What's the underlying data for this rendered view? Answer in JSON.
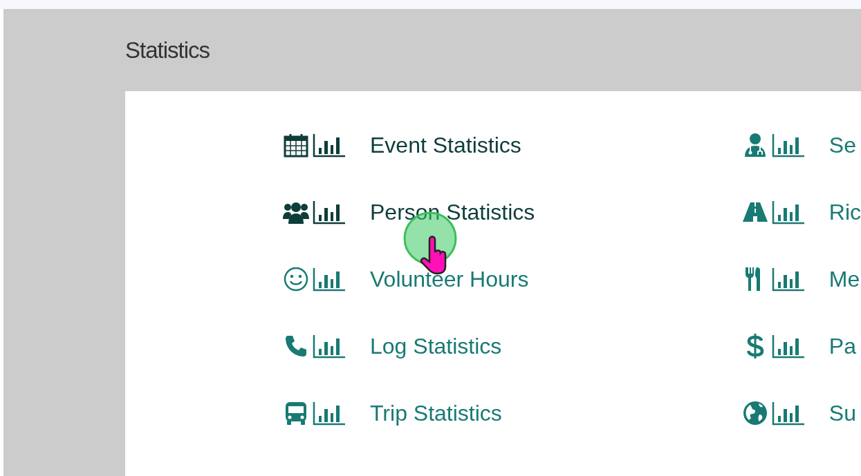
{
  "page": {
    "title": "Statistics"
  },
  "columns": [
    {
      "items": [
        {
          "kind": "calendar",
          "label": "Event Statistics",
          "visited": true
        },
        {
          "kind": "people",
          "label": "Person Statistics",
          "visited": true
        },
        {
          "kind": "smiley",
          "label": "Volunteer Hours",
          "visited": false
        },
        {
          "kind": "phone",
          "label": "Log Statistics",
          "visited": false
        },
        {
          "kind": "bus",
          "label": "Trip Statistics",
          "visited": false
        }
      ]
    },
    {
      "items": [
        {
          "kind": "doctor",
          "label": "Se",
          "visited": false
        },
        {
          "kind": "road",
          "label": "Ric",
          "visited": false
        },
        {
          "kind": "utensils",
          "label": "Me",
          "visited": false
        },
        {
          "kind": "dollar",
          "label": "Pa",
          "visited": false
        },
        {
          "kind": "globe",
          "label": "Su",
          "visited": false
        }
      ]
    }
  ]
}
